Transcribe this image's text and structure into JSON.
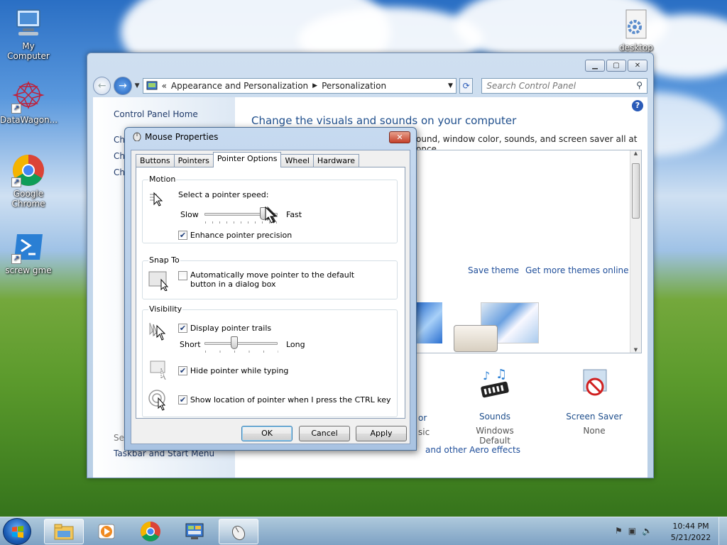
{
  "desktop": {
    "icons": [
      {
        "label": "My Computer"
      },
      {
        "label": "DataWagon..."
      },
      {
        "label": "Google Chrome"
      },
      {
        "label": "screw gme"
      },
      {
        "label": "desktop"
      }
    ]
  },
  "control_panel": {
    "breadcrumb": [
      "Appearance and Personalization",
      "Personalization"
    ],
    "breadcrumb_prefix": "«",
    "search_placeholder": "Search Control Panel",
    "left": {
      "home_link": "Control Panel Home",
      "links": [
        "Ch",
        "Ch",
        "Ch"
      ],
      "see_also": "See",
      "taskbar_link": "Taskbar and Start Menu"
    },
    "heading": "Change the visuals and sounds on your computer",
    "subtitle": "ound, window color, sounds, and screen saver all at once.",
    "save_theme": "Save theme",
    "get_more_themes": "Get more themes online",
    "bottom_items": [
      {
        "label": "or",
        "sub": "sic"
      },
      {
        "label": "Sounds",
        "sub": "Windows Default"
      },
      {
        "label": "Screen Saver",
        "sub": "None"
      }
    ],
    "aero_link": "and other Aero effects"
  },
  "mouse_dialog": {
    "title": "Mouse Properties",
    "tabs": [
      "Buttons",
      "Pointers",
      "Pointer Options",
      "Wheel",
      "Hardware"
    ],
    "active_tab": "Pointer Options",
    "motion": {
      "group": "Motion",
      "speed_label": "Select a pointer speed:",
      "slow": "Slow",
      "fast": "Fast",
      "speed_value": 0.8,
      "precision_label": "Enhance pointer precision",
      "precision_checked": true
    },
    "snap_to": {
      "group": "Snap To",
      "label": "Automatically move pointer to the default button in a dialog box",
      "checked": false
    },
    "visibility": {
      "group": "Visibility",
      "trails_label": "Display pointer trails",
      "trails_checked": true,
      "short": "Short",
      "long": "Long",
      "trail_value": 0.4,
      "hide_label": "Hide pointer while typing",
      "hide_checked": true,
      "ctrl_label": "Show location of pointer when I press the CTRL key",
      "ctrl_checked": true
    },
    "buttons": {
      "ok": "OK",
      "cancel": "Cancel",
      "apply": "Apply"
    }
  },
  "taskbar": {
    "time": "10:44 PM",
    "date": "5/21/2022"
  }
}
